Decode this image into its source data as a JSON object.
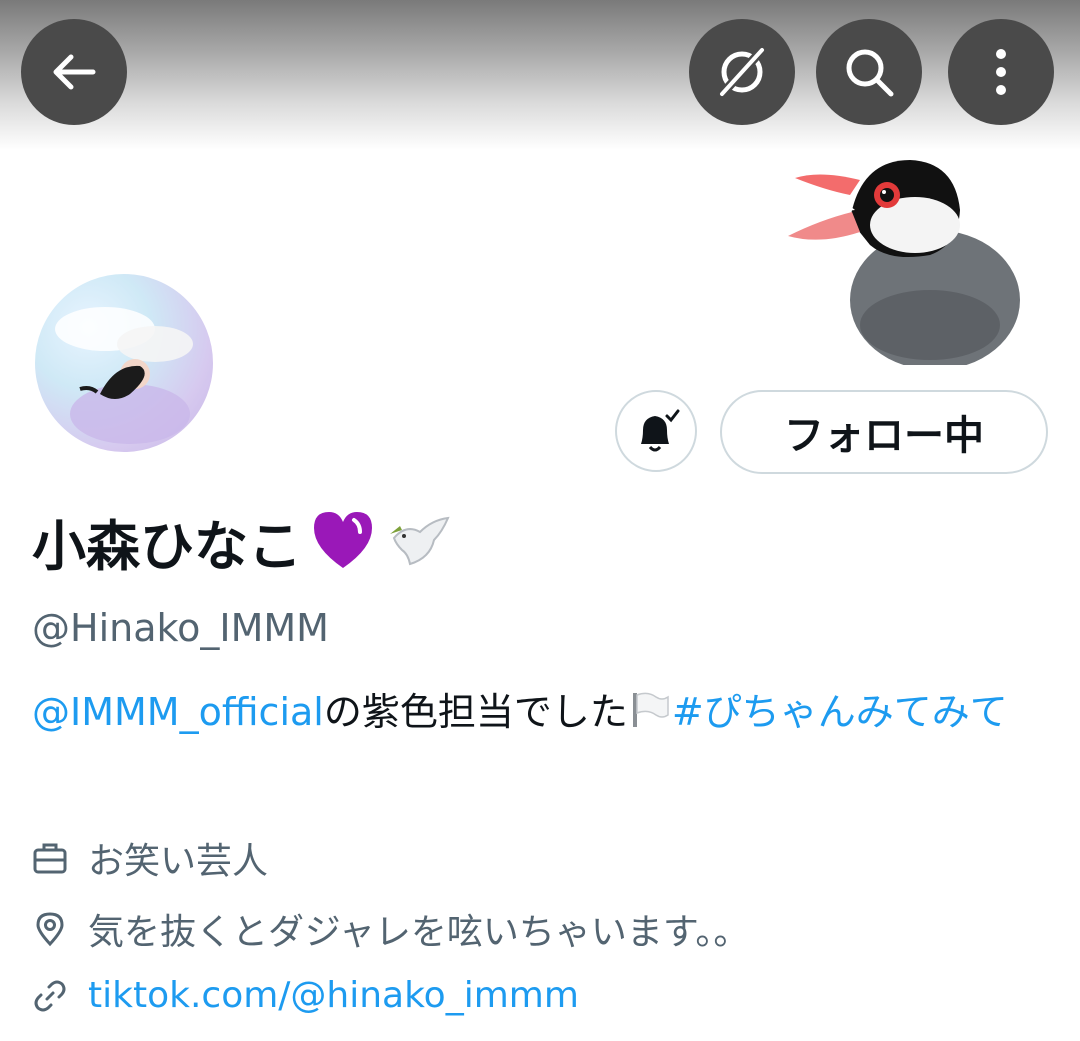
{
  "header": {
    "back_icon": "arrow-left-icon",
    "translate_icon": "translate-slash-icon",
    "search_icon": "search-icon",
    "more_icon": "more-vertical-icon"
  },
  "profile": {
    "display_name": "小森ひなこ",
    "name_emojis": [
      "purple-heart",
      "dove-with-olive-branch"
    ],
    "handle": "@Hinako_IMMM",
    "follow_button": "フォロー中",
    "bell_icon": "notification-bell-check-icon",
    "bio": {
      "mention": "@IMMM_official",
      "text": "の紫色担当でした",
      "emoji": "white-flag",
      "hashtag": "#ぴちゃんみてみて"
    },
    "job": "お笑い芸人",
    "location": "気を抜くとダジャレを呟いちゃいます。。",
    "url": "tiktok.com/@hinako_immm"
  },
  "colors": {
    "link": "#1d9bf0",
    "secondary_text": "#536471",
    "primary_text": "#0f1419",
    "button_border": "#cfd9de",
    "header_button_bg": "#4a4a4a"
  }
}
